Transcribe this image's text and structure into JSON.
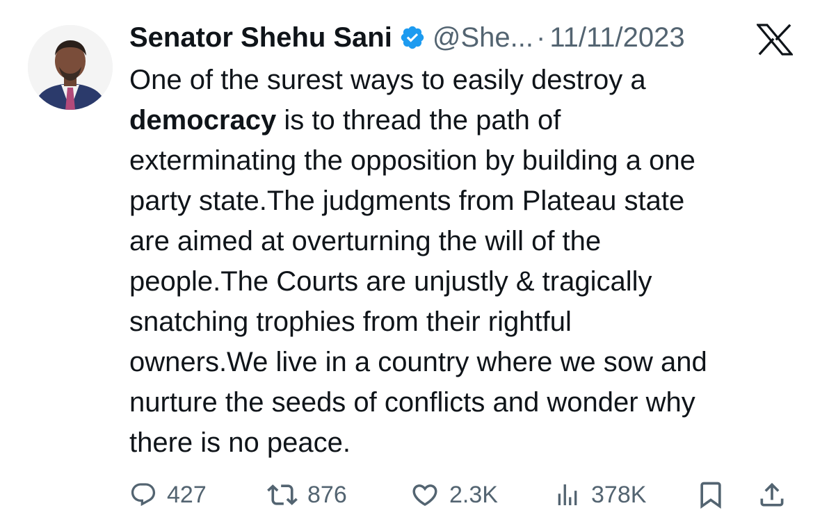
{
  "author": {
    "display_name": "Senator Shehu Sani",
    "handle": "@She...",
    "verified": true,
    "avatar_icon": "profile-photo"
  },
  "meta": {
    "separator": "·",
    "date": "11/11/2023",
    "platform_icon": "x-logo-icon"
  },
  "tweet": {
    "lines": [
      [
        "One of the surest ways to easily destroy a",
        ""
      ],
      [
        "democracy",
        " is to thread the path of"
      ],
      [
        "exterminating the opposition by building a one",
        ""
      ],
      [
        "party state.The judgments from Plateau state",
        ""
      ],
      [
        "are aimed at overturning the will of the",
        ""
      ],
      [
        "people.The Courts are unjustly & tragically",
        ""
      ],
      [
        "snatching trophies from their rightful",
        ""
      ],
      [
        "owners.We live in a country where we sow and",
        ""
      ],
      [
        "nurture the seeds of conflicts and wonder why",
        ""
      ],
      [
        "there is no peace.",
        ""
      ]
    ]
  },
  "actions": {
    "replies": "427",
    "reposts": "876",
    "likes": "2.3K",
    "views": "378K"
  },
  "colors": {
    "text": "#0f1419",
    "secondary": "#536471",
    "verified_blue": "#1d9bf0",
    "background": "#ffffff"
  }
}
